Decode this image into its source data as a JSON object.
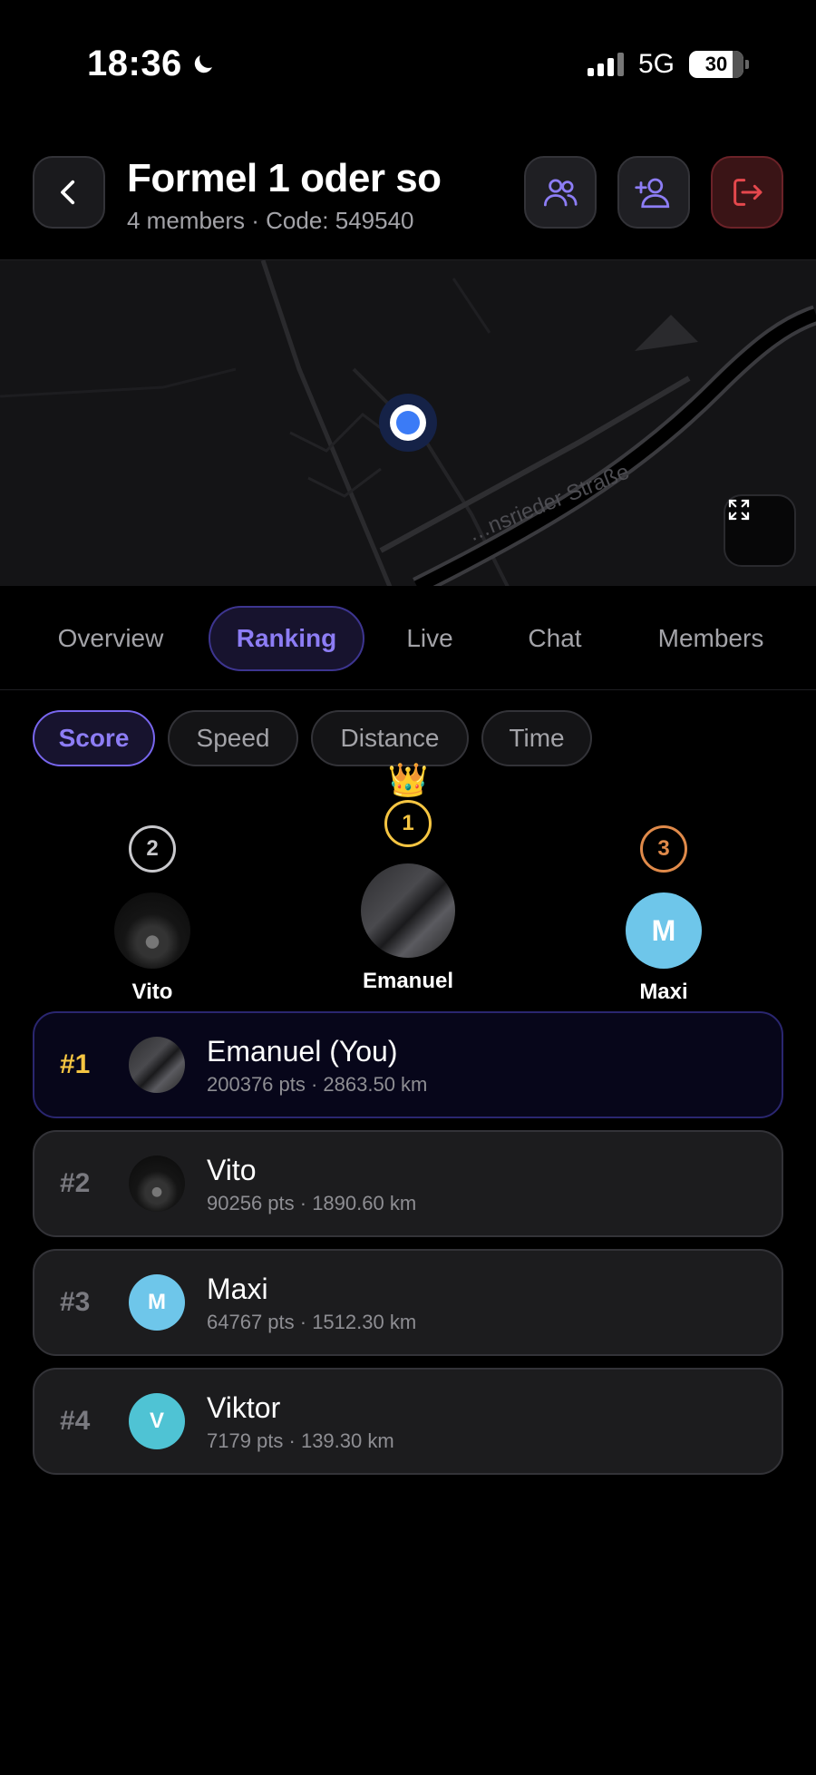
{
  "status_bar": {
    "time": "18:36",
    "network": "5G",
    "battery": "30"
  },
  "header": {
    "title": "Formel 1 oder so",
    "subtitle": "4 members · Code: 549540"
  },
  "map": {
    "street_label": "…nsrieder Straße"
  },
  "tabs": [
    {
      "label": "Overview",
      "active": false
    },
    {
      "label": "Ranking",
      "active": true
    },
    {
      "label": "Live",
      "active": false
    },
    {
      "label": "Chat",
      "active": false
    },
    {
      "label": "Members",
      "active": false
    }
  ],
  "metric_chips": [
    {
      "label": "Score",
      "active": true
    },
    {
      "label": "Speed",
      "active": false
    },
    {
      "label": "Distance",
      "active": false
    },
    {
      "label": "Time",
      "active": false
    }
  ],
  "podium": [
    {
      "rank": "2",
      "name": "Vito",
      "ring_color": "#c8c8cc",
      "avatar": "photo"
    },
    {
      "rank": "1",
      "name": "Emanuel",
      "ring_color": "#f5c542",
      "avatar": "photo",
      "crown": "👑"
    },
    {
      "rank": "3",
      "name": "Maxi",
      "ring_color": "#e08a4a",
      "avatar": "M",
      "avatar_color": "#6ec6ea"
    }
  ],
  "ranking": [
    {
      "rank": "#1",
      "name": "Emanuel (You)",
      "stats": "200376 pts · 2863.50 km",
      "avatar": "photo",
      "is_me": true
    },
    {
      "rank": "#2",
      "name": "Vito",
      "stats": "90256 pts · 1890.60 km",
      "avatar": "photo",
      "is_me": false
    },
    {
      "rank": "#3",
      "name": "Maxi",
      "stats": "64767 pts · 1512.30 km",
      "avatar": "M",
      "avatar_color": "#6ec6ea",
      "is_me": false
    },
    {
      "rank": "#4",
      "name": "Viktor",
      "stats": "7179 pts · 139.30 km",
      "avatar": "V",
      "avatar_color": "#4fc3d4",
      "is_me": false
    }
  ],
  "colors": {
    "accent": "#8d7df5",
    "gold": "#f5c542",
    "danger": "#e5484d",
    "location_dot": "#3b7bf6"
  }
}
